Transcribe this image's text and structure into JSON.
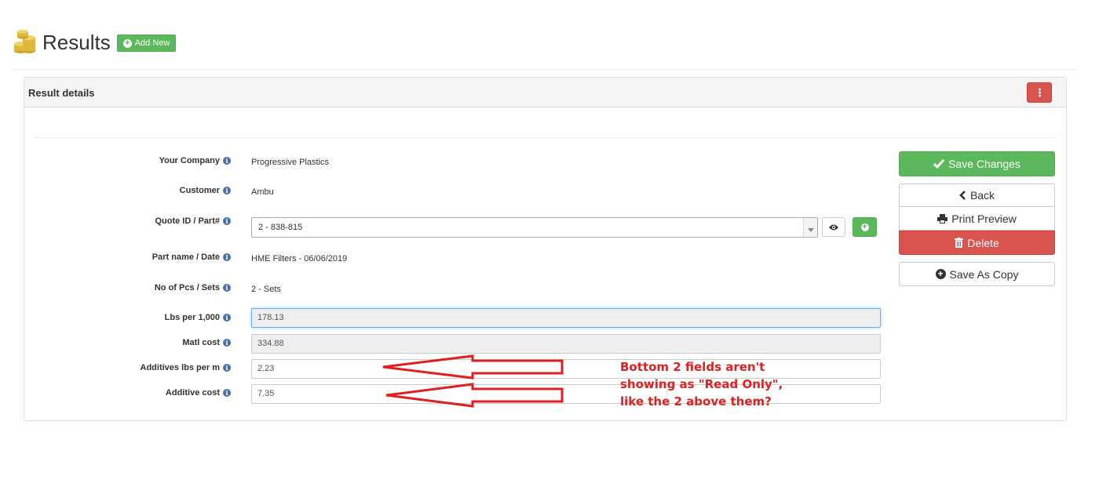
{
  "header": {
    "title": "Results",
    "add_new_label": "Add New"
  },
  "panel": {
    "title": "Result details"
  },
  "fields": {
    "company": {
      "label": "Your Company",
      "value": "Progressive Plastics"
    },
    "customer": {
      "label": "Customer",
      "value": "Ambu"
    },
    "quote": {
      "label": "Quote ID / Part#",
      "value": "2 - 838-815"
    },
    "partname": {
      "label": "Part name / Date",
      "value": "HME Filters - 06/06/2019"
    },
    "pcs": {
      "label": "No of Pcs / Sets",
      "value": "2 - Sets"
    },
    "lbs": {
      "label": "Lbs per 1,000",
      "value": "178.13"
    },
    "matl": {
      "label": "Matl cost",
      "value": "334.88"
    },
    "additives": {
      "label": "Additives lbs per m",
      "value": "2.23"
    },
    "addcost": {
      "label": "Additive cost",
      "value": "7.35"
    }
  },
  "actions": {
    "save": "Save Changes",
    "back": "Back",
    "print": "Print Preview",
    "delete": "Delete",
    "copy": "Save As Copy"
  },
  "annotation": {
    "line1": "Bottom 2 fields aren't",
    "line2": "showing as \"Read Only\",",
    "line3": "like the 2 above them?"
  },
  "colors": {
    "success": "#5cb85c",
    "danger": "#d9534f",
    "info": "#4a6fa5",
    "annotation": "#e02020"
  },
  "icons": [
    "coins-icon",
    "plus-circle-icon",
    "kebab-icon",
    "info-icon",
    "eye-icon",
    "check-icon",
    "chevron-left-icon",
    "print-icon",
    "trash-icon"
  ]
}
